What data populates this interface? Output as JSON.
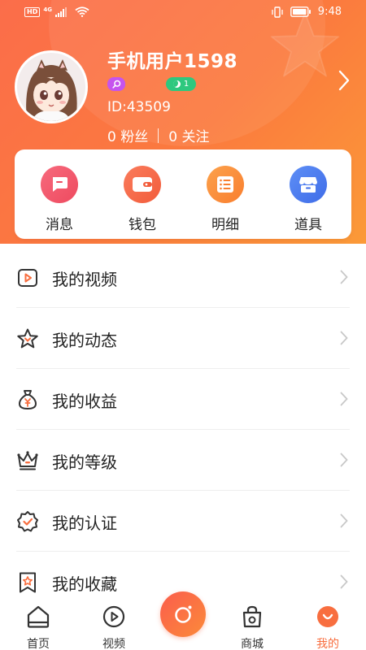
{
  "status_bar": {
    "hd": "HD",
    "network": "4G",
    "time": "9:48"
  },
  "profile": {
    "username": "手机用户1598",
    "level_badge_count": "1",
    "user_id": "ID:43509",
    "fans_count_label": "0 粉丝",
    "following_count_label": "0 关注"
  },
  "quick_actions": [
    {
      "label": "消息",
      "icon": "message-icon",
      "color": "#f2566c"
    },
    {
      "label": "钱包",
      "icon": "wallet-icon",
      "color": "#f56a45"
    },
    {
      "label": "明细",
      "icon": "list-detail-icon",
      "color": "#fb8b3a"
    },
    {
      "label": "道具",
      "icon": "shop-icon",
      "color": "#4a7ff0"
    }
  ],
  "menu": [
    {
      "label": "我的视频",
      "icon": "video-icon"
    },
    {
      "label": "我的动态",
      "icon": "star-icon"
    },
    {
      "label": "我的收益",
      "icon": "money-bag-icon"
    },
    {
      "label": "我的等级",
      "icon": "crown-icon"
    },
    {
      "label": "我的认证",
      "icon": "certified-icon"
    },
    {
      "label": "我的收藏",
      "icon": "bookmark-star-icon"
    }
  ],
  "bottom_nav": [
    {
      "label": "首页",
      "icon": "home-icon"
    },
    {
      "label": "视频",
      "icon": "video-tab-icon"
    },
    {
      "label": "",
      "icon": "camera-icon"
    },
    {
      "label": "商城",
      "icon": "shopping-bag-icon"
    },
    {
      "label": "我的",
      "icon": "smile-face-icon",
      "active": true
    }
  ],
  "colors": {
    "accent": "#f86e3f",
    "header_start": "#fb6d4a",
    "header_end": "#fb9a38",
    "icon_accent": "#f86e3f",
    "text_dark": "#222222"
  }
}
